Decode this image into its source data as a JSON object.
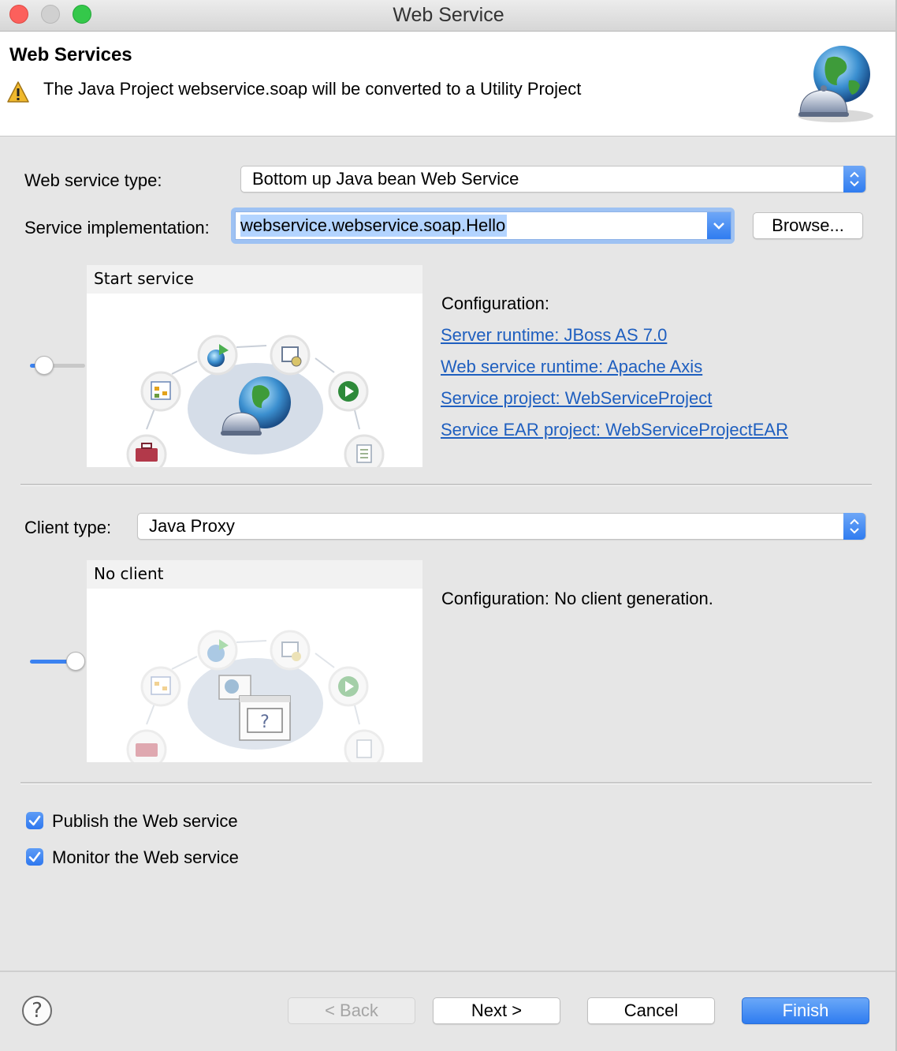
{
  "window": {
    "title": "Web Service"
  },
  "banner": {
    "title": "Web Services",
    "message": "The Java Project webservice.soap will be converted to a Utility Project"
  },
  "service": {
    "type_label": "Web service type:",
    "type_value": "Bottom up Java bean Web Service",
    "impl_label": "Service implementation:",
    "impl_value": "webservice.webservice.soap.Hello",
    "browse_label": "Browse...",
    "slider_caption": "Start service",
    "config_heading": "Configuration:",
    "links": [
      "Server runtime: JBoss AS 7.0",
      "Web service runtime: Apache Axis",
      "Service project: WebServiceProject",
      "Service EAR project: WebServiceProjectEAR"
    ]
  },
  "client": {
    "type_label": "Client type:",
    "type_value": "Java Proxy",
    "slider_caption": "No client",
    "config_text": "Configuration: No client generation."
  },
  "options": {
    "publish_label": "Publish the Web service",
    "publish_checked": true,
    "monitor_label": "Monitor the Web service",
    "monitor_checked": true
  },
  "footer": {
    "help_symbol": "?",
    "back_label": "< Back",
    "next_label": "Next >",
    "cancel_label": "Cancel",
    "finish_label": "Finish"
  },
  "colors": {
    "accent": "#2f7cf0",
    "link": "#1f5fbf",
    "warning": "#f0b92d"
  },
  "icons": [
    "warning-icon",
    "globe-bell-icon",
    "globe-icon",
    "toolbox-icon",
    "diagram-icon",
    "deploy-icon",
    "server-icon",
    "play-icon",
    "document-icon",
    "help-icon",
    "checkmark-icon"
  ]
}
